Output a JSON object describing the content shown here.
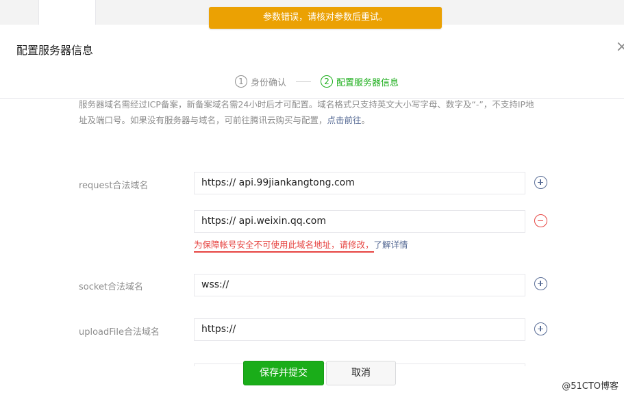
{
  "toast": {
    "message": "参数错误，请核对参数后重试。"
  },
  "dialog": {
    "title": "配置服务器信息",
    "close_glyph": "×"
  },
  "steps": [
    {
      "num": "1",
      "label": "身份确认"
    },
    {
      "num": "2",
      "label": "配置服务器信息"
    }
  ],
  "tips": {
    "text": "服务器域名需经过ICP备案，新备案域名需24小时后才可配置。域名格式只支持英文大小写字母、数字及“-”，不支持IP地址及端口号。如果没有服务器与域名，可前往腾讯云购买与配置，",
    "link": "点击前往",
    "end": "。"
  },
  "form": {
    "request": {
      "label": "request合法域名",
      "values": [
        "https:// api.99jiankangtong.com",
        "https:// api.weixin.qq.com"
      ]
    },
    "request_error": {
      "text": "为保障帐号安全不可使用此域名地址，请修改，",
      "link": "了解详情"
    },
    "socket": {
      "label": "socket合法域名",
      "value": "wss://"
    },
    "upload": {
      "label": "uploadFile合法域名",
      "value": "https://"
    }
  },
  "buttons": {
    "submit": "保存并提交",
    "cancel": "取消"
  },
  "watermark": "@51CTO博客",
  "colors": {
    "warning": "#eba103",
    "success": "#1aad19",
    "danger": "#e64340",
    "link": "#576b95"
  }
}
